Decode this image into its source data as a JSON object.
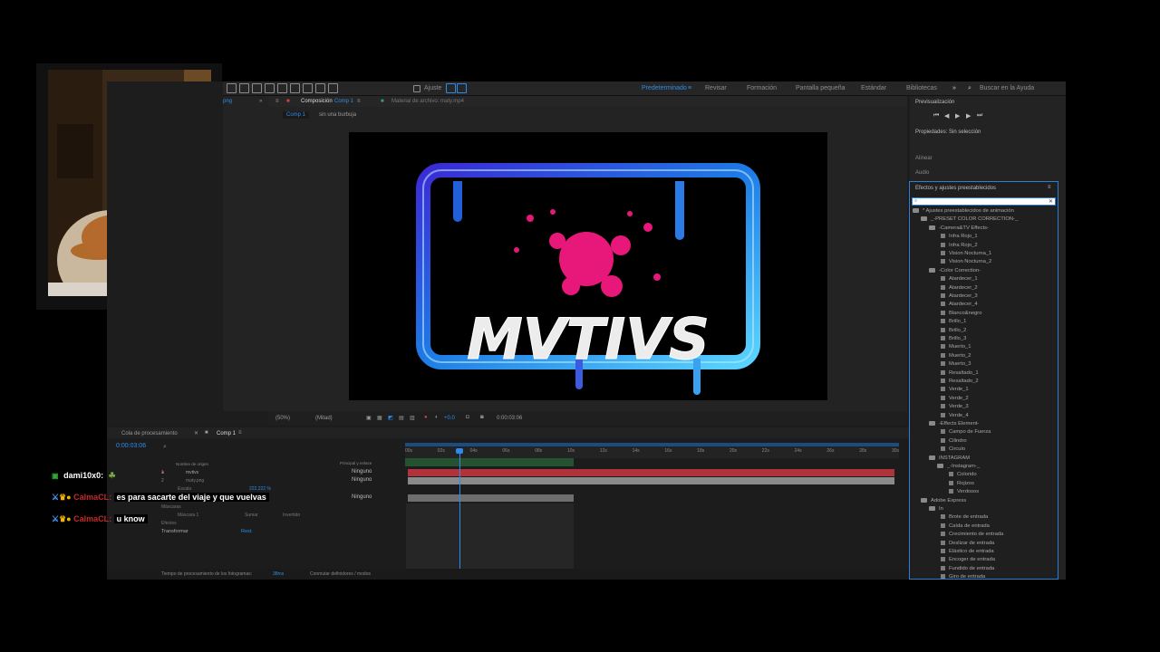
{
  "toolbar": {
    "workspaces": [
      "Predeterminado",
      "Revisar",
      "Formación",
      "Pantalla pequeña",
      "Estándar",
      "Bibliotecas"
    ],
    "active_workspace": "Predeterminado",
    "ajuste_label": "Ajuste",
    "search_placeholder": "Buscar en la Ayuda"
  },
  "left_panel": {
    "tab_label": "png"
  },
  "viewer": {
    "composition_tab": "Composición",
    "composition_name": "Comp 1",
    "footage_tab": "Material de archivo: maty.mp4",
    "comp_breadcrumb": "Comp 1",
    "comp_breadcrumb_2": "sin una burbuja",
    "zoom": "(50%)",
    "resolution": "(Mitad)",
    "exposure": "+0.0",
    "timecode": "0:00:03:06",
    "canvas_title": "MVTIVS"
  },
  "right_panel": {
    "preview_title": "Previsualización",
    "properties_title": "Propiedades: Sin selección",
    "align_title": "Alinear",
    "audio_title": "Audio",
    "effects_title": "Efectos y ajustes preestablecidos",
    "search_value": "",
    "tree": [
      {
        "label": "* Ajustes preestablecidos de animación",
        "level": 0,
        "type": "folder"
      },
      {
        "label": "_-PRESET COLOR CORRECTION-_",
        "level": 1,
        "type": "folder"
      },
      {
        "label": "-Camera&TV Effects-",
        "level": 2,
        "type": "folder"
      },
      {
        "label": "Infra Rojo_1",
        "level": 3,
        "type": "item"
      },
      {
        "label": "Infra Rojo_2",
        "level": 3,
        "type": "item"
      },
      {
        "label": "Vision Nocturna_1",
        "level": 3,
        "type": "item"
      },
      {
        "label": "Vision Nocturna_2",
        "level": 3,
        "type": "item"
      },
      {
        "label": "-Color Correction-",
        "level": 2,
        "type": "folder"
      },
      {
        "label": "Atardecer_1",
        "level": 3,
        "type": "item"
      },
      {
        "label": "Atardecer_2",
        "level": 3,
        "type": "item"
      },
      {
        "label": "Atardecer_3",
        "level": 3,
        "type": "item"
      },
      {
        "label": "Atardecer_4",
        "level": 3,
        "type": "item"
      },
      {
        "label": "Blanco&negro",
        "level": 3,
        "type": "item"
      },
      {
        "label": "Brillo_1",
        "level": 3,
        "type": "item"
      },
      {
        "label": "Brillo_2",
        "level": 3,
        "type": "item"
      },
      {
        "label": "Brillo_3",
        "level": 3,
        "type": "item"
      },
      {
        "label": "Muerto_1",
        "level": 3,
        "type": "item"
      },
      {
        "label": "Muerto_2",
        "level": 3,
        "type": "item"
      },
      {
        "label": "Muerto_3",
        "level": 3,
        "type": "item"
      },
      {
        "label": "Resaltado_1",
        "level": 3,
        "type": "item"
      },
      {
        "label": "Resaltado_2",
        "level": 3,
        "type": "item"
      },
      {
        "label": "Verde_1",
        "level": 3,
        "type": "item"
      },
      {
        "label": "Verde_2",
        "level": 3,
        "type": "item"
      },
      {
        "label": "Verde_3",
        "level": 3,
        "type": "item"
      },
      {
        "label": "Verde_4",
        "level": 3,
        "type": "item"
      },
      {
        "label": "-Effects Element-",
        "level": 2,
        "type": "folder"
      },
      {
        "label": "Campo de Fuerza",
        "level": 3,
        "type": "item"
      },
      {
        "label": "Cilindro",
        "level": 3,
        "type": "item"
      },
      {
        "label": "Circulo",
        "level": 3,
        "type": "item"
      },
      {
        "label": "INSTAGRAM",
        "level": 2,
        "type": "folder"
      },
      {
        "label": "_-Instagram-_",
        "level": 3,
        "type": "folder"
      },
      {
        "label": "Colorido",
        "level": 4,
        "type": "item"
      },
      {
        "label": "Rojizos",
        "level": 4,
        "type": "item"
      },
      {
        "label": "Verdosos",
        "level": 4,
        "type": "item"
      },
      {
        "label": "Adobe Express",
        "level": 1,
        "type": "folder"
      },
      {
        "label": "In",
        "level": 2,
        "type": "folder"
      },
      {
        "label": "Brote de entrada",
        "level": 3,
        "type": "item"
      },
      {
        "label": "Caída de entrada",
        "level": 3,
        "type": "item"
      },
      {
        "label": "Crecimiento de entrada",
        "level": 3,
        "type": "item"
      },
      {
        "label": "Deslizar de entrada",
        "level": 3,
        "type": "item"
      },
      {
        "label": "Elástico de entrada",
        "level": 3,
        "type": "item"
      },
      {
        "label": "Encoger de entrada",
        "level": 3,
        "type": "item"
      },
      {
        "label": "Fundido de entrada",
        "level": 3,
        "type": "item"
      },
      {
        "label": "Giro de entrada",
        "level": 3,
        "type": "item"
      }
    ]
  },
  "timeline": {
    "render_queue_tab": "Cola de procesamiento",
    "comp_tab": "Comp 1",
    "timecode": "0:00:03:06",
    "column_source": "Nombre de origen",
    "column_parent": "Principal y enlace",
    "layers": [
      {
        "num": "1",
        "name": "mvtivs",
        "parent": "Ninguno"
      },
      {
        "num": "2",
        "name": "maty.png",
        "parent": "Ninguno"
      }
    ],
    "escala_label": "Escala",
    "escala_value": "222,222 %",
    "mascaras_label": "Máscaras",
    "mascara_label": "Máscara 1",
    "mascara_mode": "Sumar",
    "mascara_inverted": "Invertido",
    "efectos_label": "Efectos",
    "transformar_label": "Transformar",
    "restablecer_label": "Rest.",
    "third_parent": "Ninguno",
    "ruler": [
      "00s",
      "02s",
      "04s",
      "06s",
      "08s",
      "10s",
      "12s",
      "14s",
      "16s",
      "18s",
      "20s",
      "22s",
      "24s",
      "26s",
      "28s",
      "30s"
    ],
    "status_render": "Tiempo de procesamiento de los fotogramas:",
    "status_ms": "38ms",
    "status_toggle": "Conmutar definidores / modos"
  },
  "chat": [
    {
      "user": "dami10x0:",
      "message": ""
    },
    {
      "user": "CalmaCL:",
      "message": "es para sacarte del viaje y que vuelvas"
    },
    {
      "user": "CalmaCL:",
      "message": "u know"
    }
  ],
  "colors": {
    "accent": "#2d8ceb",
    "splash": "#e8177a",
    "layer1_bar": "#b0333b",
    "layer2_bar": "#8a8a8a"
  }
}
